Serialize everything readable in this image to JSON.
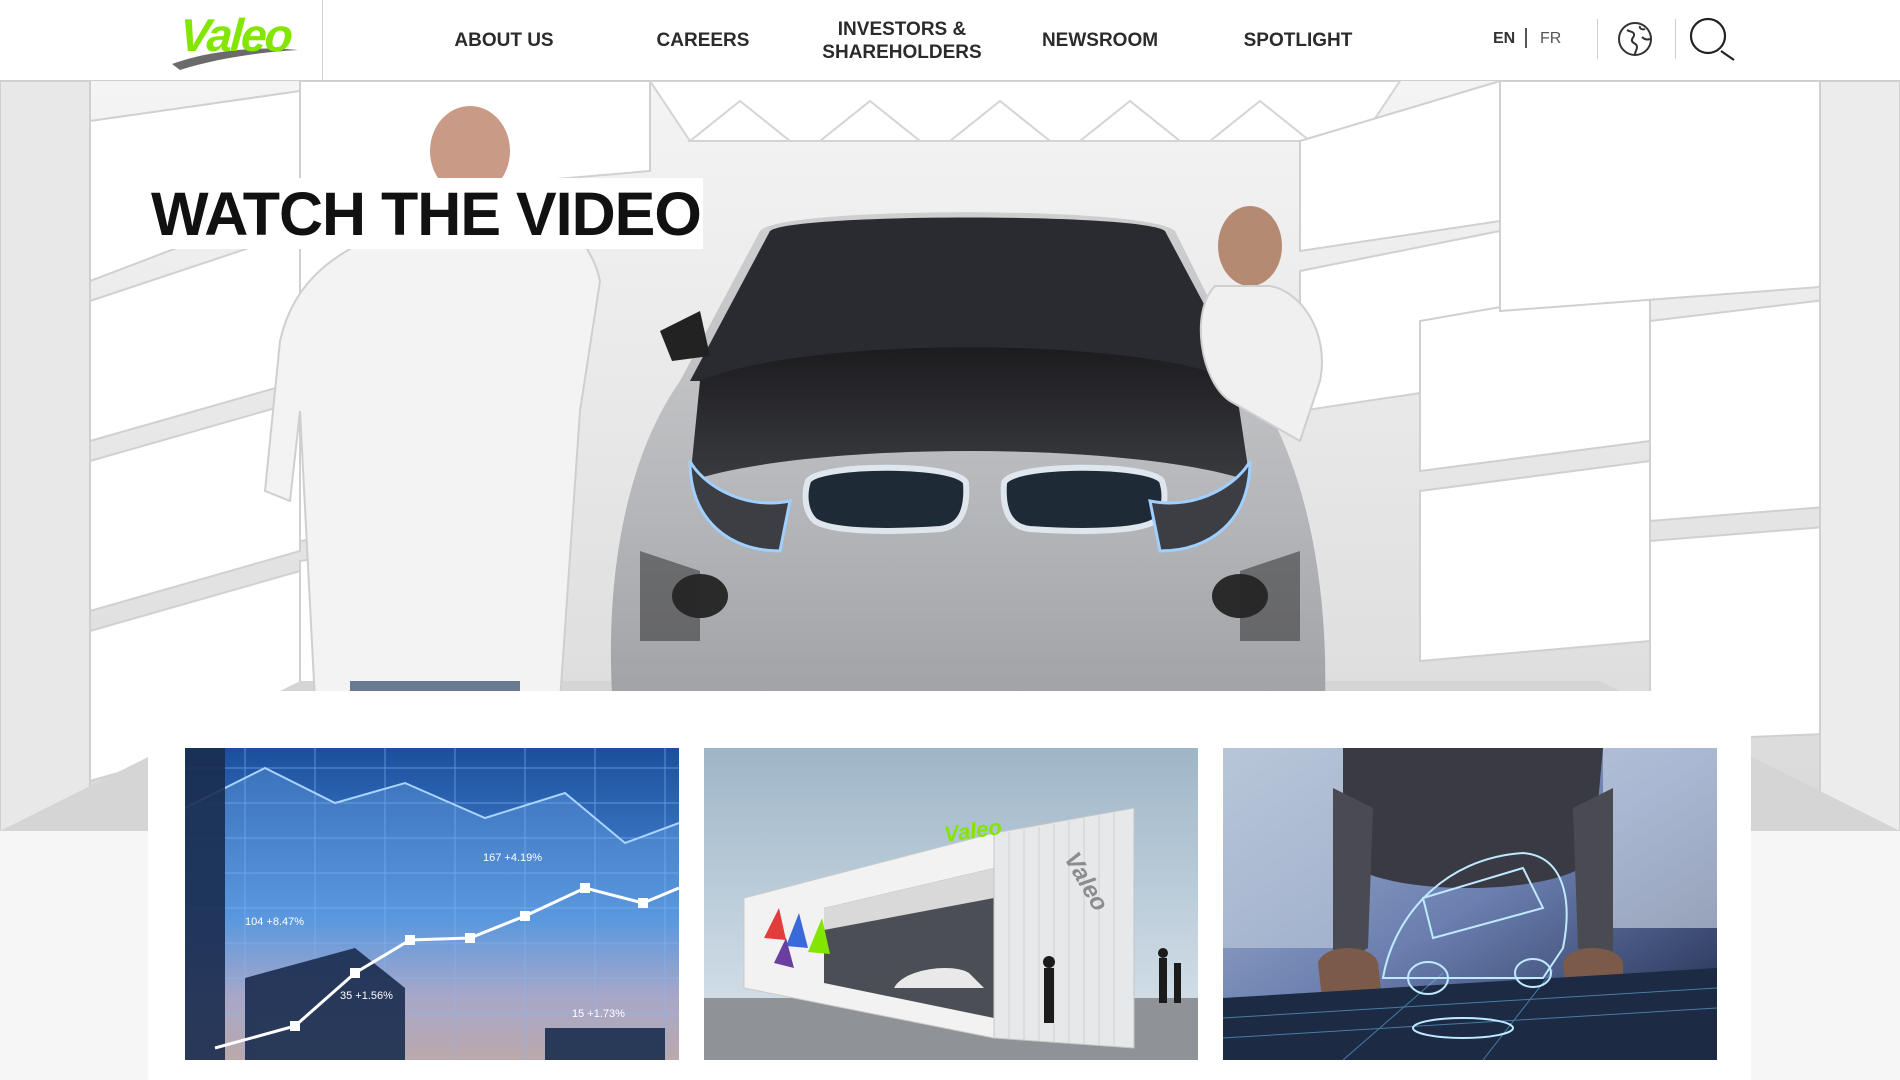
{
  "brand": {
    "logo_text": "Valeo",
    "accent_color": "#82e600"
  },
  "nav": {
    "items": [
      {
        "label": "ABOUT US"
      },
      {
        "label": "CAREERS"
      },
      {
        "label": "INVESTORS & SHAREHOLDERS"
      },
      {
        "label": "NEWSROOM"
      },
      {
        "label": "SPOTLIGHT"
      }
    ]
  },
  "lang": {
    "en": "EN",
    "fr": "FR",
    "active": "EN"
  },
  "icons": {
    "globe": "globe-icon",
    "search": "search-icon"
  },
  "hero": {
    "title": "WATCH THE VIDEO"
  },
  "cards": [
    {
      "topic": "stock-chart",
      "labels": [
        "167 +4.19%",
        "104 +8.47%",
        "35 +1.56%",
        "15 +1.73%"
      ]
    },
    {
      "topic": "exhibition-pavilion",
      "sign_text": "Valeo"
    },
    {
      "topic": "holographic-car"
    }
  ]
}
